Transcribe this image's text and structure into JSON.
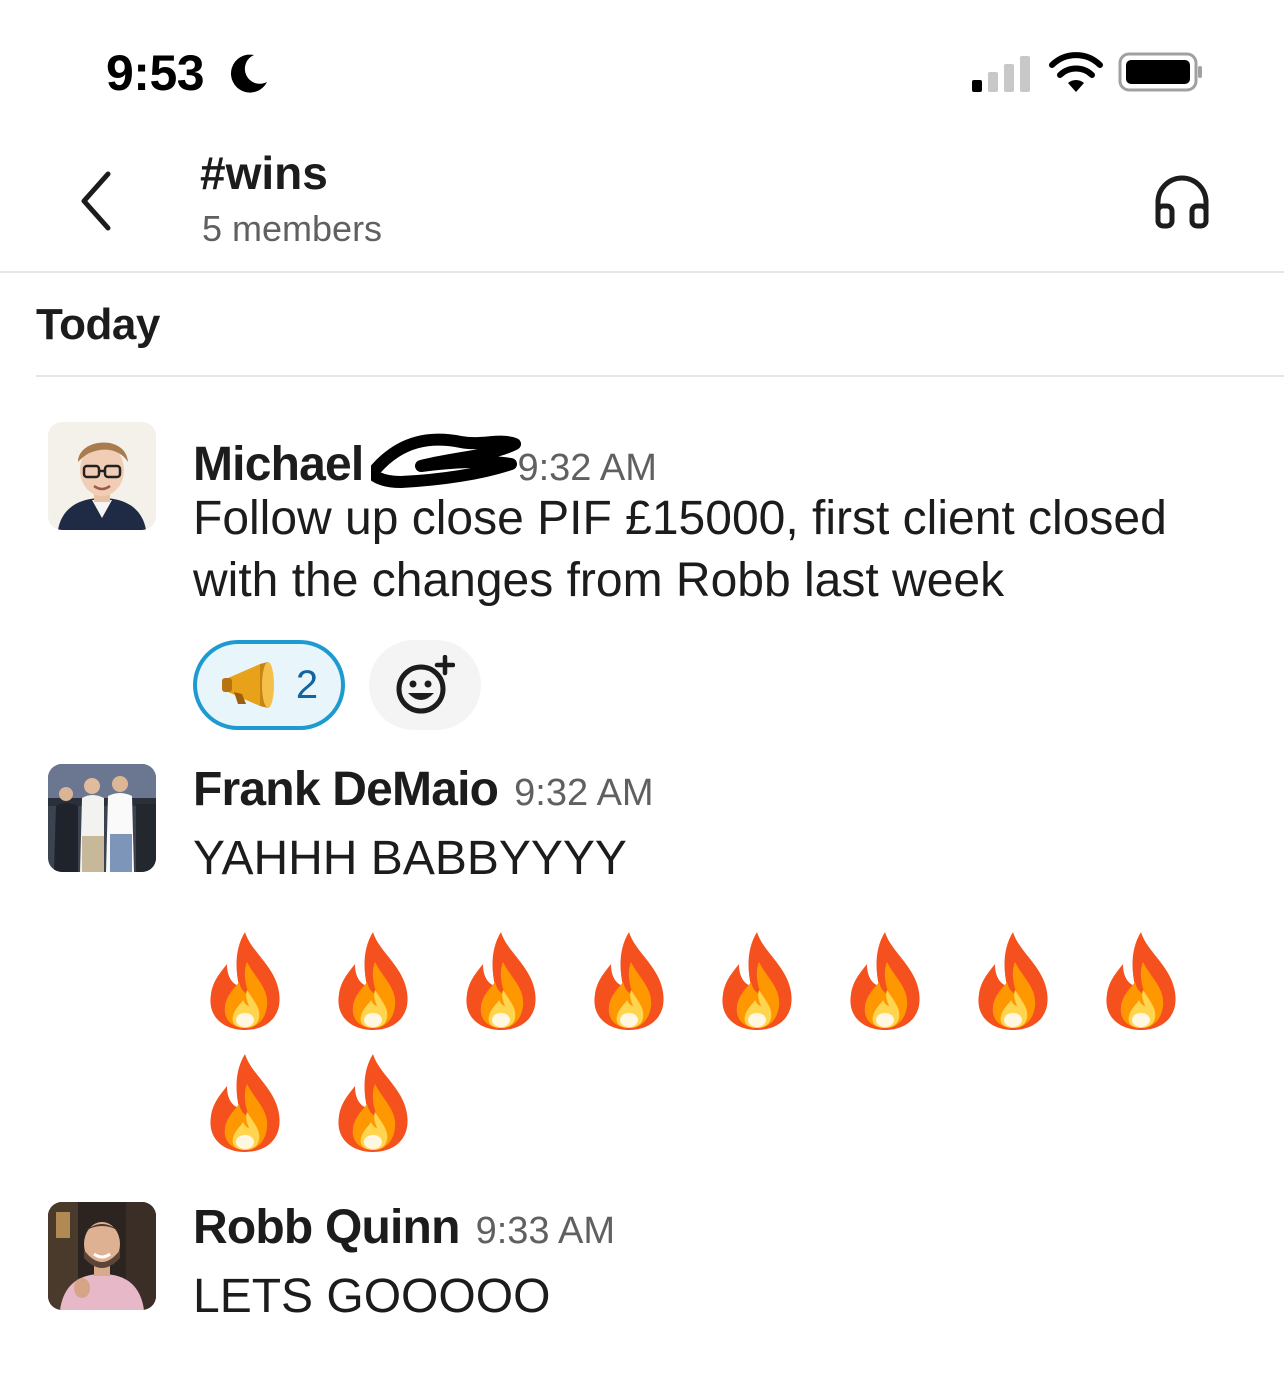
{
  "status_bar": {
    "time": "9:53",
    "icons": [
      "moon-icon",
      "signal-icon",
      "wifi-icon",
      "battery-icon"
    ]
  },
  "header": {
    "channel_name": "#wins",
    "members": "5 members",
    "icons": [
      "back-chevron-icon",
      "headphones-icon"
    ]
  },
  "day_divider": "Today",
  "messages": [
    {
      "sender": "Michael",
      "time": "9:32 AM",
      "text": "Follow up close PIF £15000, first client closed with the changes from Robb last week",
      "reactions": [
        {
          "emoji": "megaphone-icon",
          "count": "2"
        }
      ],
      "add_reaction_icon": "add-reaction-icon"
    },
    {
      "sender": "Frank DeMaio",
      "time": "9:32 AM",
      "text": "YAHHH BABBYYYY",
      "emoji_rows": [
        [
          "fire-icon",
          "fire-icon",
          "fire-icon",
          "fire-icon",
          "fire-icon",
          "fire-icon",
          "fire-icon",
          "fire-icon"
        ],
        [
          "fire-icon",
          "fire-icon"
        ]
      ]
    },
    {
      "sender": "Robb Quinn",
      "time": "9:33 AM",
      "text": "LETS GOOOOO"
    }
  ],
  "colors": {
    "text": "#1d1c1d",
    "muted": "#616061",
    "reaction_border": "#1d9bd1",
    "reaction_bg": "#e8f5fa",
    "reaction_count": "#1264a3"
  }
}
